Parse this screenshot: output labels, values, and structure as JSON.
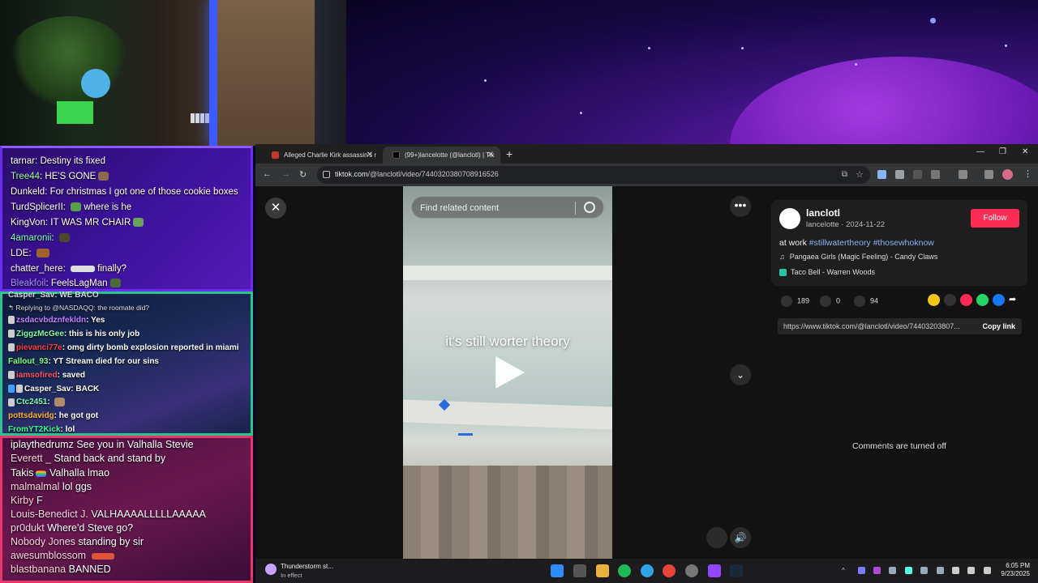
{
  "chat1": {
    "lines": [
      {
        "user": "tarnar",
        "user_color": "#ffffff",
        "text": "Destiny its fixed"
      },
      {
        "user": "Tree44",
        "user_color": "#9cff9c",
        "text": "HE'S GONE"
      },
      {
        "user": "Dunkeld",
        "user_color": "#ffffff",
        "text": "For christmas I got one of those cookie boxes"
      },
      {
        "user": "TurdSplicerII",
        "user_color": "#ffffff",
        "text": "where is he"
      },
      {
        "user": "KingVon",
        "user_color": "#ffffff",
        "text": "IT WAS MR CHAIR"
      },
      {
        "user": "4amaronii",
        "user_color": "#7dffb0",
        "text": ""
      },
      {
        "user": "LDE",
        "user_color": "#ffffff",
        "text": ""
      },
      {
        "user": "chatter_here",
        "user_color": "#ffffff",
        "text": "finally?"
      },
      {
        "user": "Bleakfoil",
        "user_color": "#a48bff",
        "text": "FeelsLagMan"
      }
    ]
  },
  "chat2": {
    "top_partial": "Casper_Sav: WE BACO",
    "reply_note": "Replying to @NASDAQQ: the roomate did?",
    "lines": [
      {
        "user": "zsdacvbdznfekldn",
        "user_color": "#c07dff",
        "text": "Yes"
      },
      {
        "user": "ZiggzMcGee",
        "user_color": "#7dff9c",
        "text": "this is his only job"
      },
      {
        "user": "pievanci77e",
        "user_color": "#ff3b3b",
        "text": "omg dirty bomb explosion reported in miami"
      },
      {
        "user": "Fallout_93",
        "user_color": "#7dff7d",
        "text": "YT Stream died for our sins"
      },
      {
        "user": "iamsofired",
        "user_color": "#ff4f6a",
        "text": "saved"
      },
      {
        "user": "Casper_Sav",
        "user_color": "#ffffff",
        "text": "BACK"
      },
      {
        "user": "Ctc2451",
        "user_color": "#7dffb0",
        "text": ""
      },
      {
        "user": "pottsdavidg",
        "user_color": "#ffb13b",
        "text": "he got got"
      },
      {
        "user": "FromYT2Kick",
        "user_color": "#2bff8c",
        "text": "lol"
      }
    ]
  },
  "chat3": {
    "lines": [
      {
        "user": "iplaythedrumz",
        "user_color": "#ffffff",
        "text": "See you in Valhalla Stevie"
      },
      {
        "user": "Everett _",
        "user_color": "#ffd0e0",
        "text": "Stand back and stand by"
      },
      {
        "user": "Takis",
        "user_color": "#ffffff",
        "text": "Valhalla lmao"
      },
      {
        "user": "malmalmal",
        "user_color": "#ffd0e0",
        "text": "lol ggs"
      },
      {
        "user": "Kirby",
        "user_color": "#ffd0e0",
        "text": "F"
      },
      {
        "user": "Louis-Benedict J.",
        "user_color": "#ffd0e0",
        "text": "VALHAAAALLLLLAAAAA"
      },
      {
        "user": "pr0dukt",
        "user_color": "#ffd0e0",
        "text": "Where'd Steve go?"
      },
      {
        "user": "Nobody Jones",
        "user_color": "#ffd0e0",
        "text": "standing by sir"
      },
      {
        "user": "awesumblossom",
        "user_color": "#ffd0e0",
        "text": ""
      },
      {
        "user": "blastbanana",
        "user_color": "#ffd0e0",
        "text": "BANNED"
      }
    ]
  },
  "browser": {
    "tabs": [
      {
        "label": "Alleged Charlie Kirk assassin's r",
        "favicon_color": "#c0392b"
      },
      {
        "label": "(99+)lancelotte (@lanclotl) | Tik",
        "favicon_color": "#000000"
      }
    ],
    "url_domain": "tiktok.com",
    "url_path": "/@lanclotl/video/7440320380708916526"
  },
  "tiktok": {
    "search_placeholder": "Find related content",
    "video_caption": "it's still worter theory",
    "username": "lanclotl",
    "display_name": "lancelotte",
    "date": "2024-11-22",
    "follow_label": "Follow",
    "description_prefix": "at work",
    "hashtags": [
      "#stillwatertheory",
      "#thosewhoknow"
    ],
    "music": "Pangaea Girls (Magic Feeling) - Candy Claws",
    "location": "Taco Bell - Warren Woods",
    "likes": "189",
    "comments": "0",
    "saves": "94",
    "share_link": "https://www.tiktok.com/@lanclotl/video/74403203807...",
    "copy_link_label": "Copy link",
    "comments_off": "Comments are turned off"
  },
  "taskbar": {
    "weather_title": "Thunderstorm st...",
    "weather_sub": "In effect",
    "time": "6:05 PM",
    "date": "9/23/2025"
  }
}
